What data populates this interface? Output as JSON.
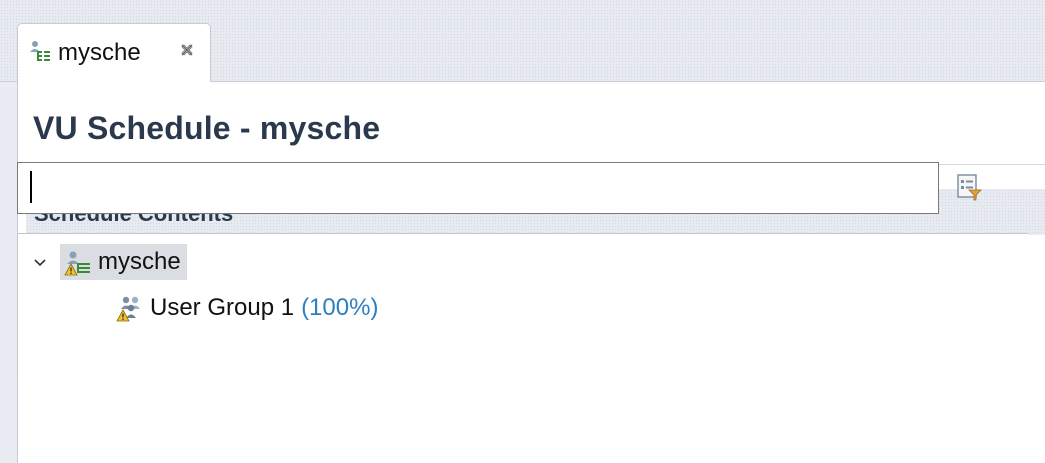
{
  "tab": {
    "label": "mysche",
    "icon": "schedule-icon",
    "close_icon": "close-icon"
  },
  "editor": {
    "title": "VU Schedule - mysche"
  },
  "section": {
    "title": "Schedule Contents",
    "filter_value": "",
    "filter_button_icon": "filter-settings-icon"
  },
  "tree": {
    "root": {
      "label": "mysche",
      "icon": "schedule-warning-icon",
      "expanded": true
    },
    "children": [
      {
        "label": "User Group 1",
        "percent": "(100%)",
        "icon": "user-group-warning-icon"
      }
    ]
  },
  "colors": {
    "title": "#2a3a4c",
    "percent": "#2e7fc0",
    "selection": "#dadde2"
  }
}
